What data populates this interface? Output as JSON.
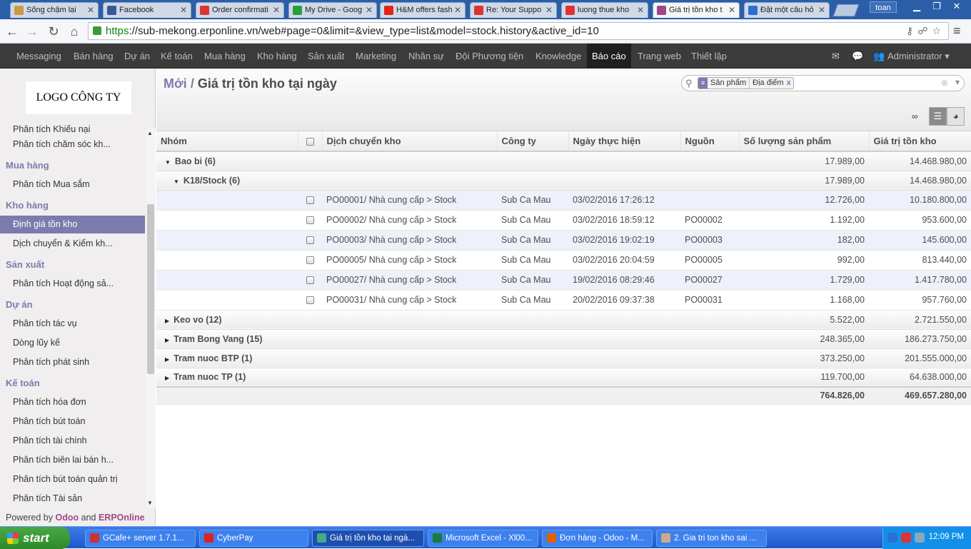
{
  "browser": {
    "tabs": [
      {
        "title": "Sống chậm lại",
        "icon": "image-icon",
        "color": "#c94"
      },
      {
        "title": "Facebook",
        "icon": "facebook-icon",
        "color": "#3b5998"
      },
      {
        "title": "Order confirmati",
        "icon": "gmail-icon",
        "color": "#d33"
      },
      {
        "title": "My Drive - Goog",
        "icon": "drive-icon",
        "color": "#2a9d3f"
      },
      {
        "title": "H&M offers fash",
        "icon": "hm-icon",
        "color": "#e1251b"
      },
      {
        "title": "Re: Your Suppo",
        "icon": "gmail-icon",
        "color": "#d33"
      },
      {
        "title": "luong thue kho",
        "icon": "gmail-icon",
        "color": "#d33"
      },
      {
        "title": "Giá trị tồn kho t",
        "icon": "odoo-icon",
        "color": "#a24689"
      },
      {
        "title": "Đặt một câu hỏ",
        "icon": "globe-icon",
        "color": "#2a6fd6"
      }
    ],
    "user": "toan",
    "url_scheme": "https",
    "url_rest": "://sub-mekong.erponline.vn/web#page=0&limit=&view_type=list&model=stock.history&active_id=10"
  },
  "topmenu": {
    "items": [
      "Messaging",
      "Bán hàng",
      "Dự án",
      "Kế toán",
      "Mua hàng",
      "Kho hàng",
      "Sản xuất",
      "Marketing",
      "Nhân sự",
      "Đội Phương tiện",
      "Knowledge",
      "Báo cáo",
      "Trang web",
      "Thiết lập"
    ],
    "active": "Báo cáo",
    "user": "Administrator"
  },
  "sidebar": {
    "logo": "LOGO CÔNG TY",
    "top_clipped": "Phân tích Khiếu nại",
    "sections": [
      {
        "title": "",
        "items": [
          "Phân tích chăm sóc kh..."
        ]
      },
      {
        "title": "Mua hàng",
        "items": [
          "Phân tích Mua sắm"
        ]
      },
      {
        "title": "Kho hàng",
        "items": [
          "Định giá tồn kho",
          "Dịch chuyển & Kiểm kh..."
        ]
      },
      {
        "title": "Sản xuất",
        "items": [
          "Phân tích Hoạt động sả..."
        ]
      },
      {
        "title": "Dự án",
        "items": [
          "Phân tích tác vụ",
          "Dòng lũy kế",
          "Phân tích phát sinh"
        ]
      },
      {
        "title": "Kế toán",
        "items": [
          "Phân tích hóa đơn",
          "Phân tích bút toán",
          "Phân tích tài chính",
          "Phân tích biên lai bán h...",
          "Phân tích bút toán quản trị",
          "Phân tích Tài sản"
        ]
      }
    ],
    "selected": "Định giá tồn kho",
    "powered_prefix": "Powered by",
    "powered_odoo": "Odoo",
    "powered_and": "and",
    "powered_erp": "ERPOnline"
  },
  "page": {
    "breadcrumb_link": "Mới",
    "breadcrumb_sep": "/",
    "title": "Giá trị tồn kho tại ngày",
    "facets": [
      "Sản phẩm",
      "Địa điểm"
    ],
    "infinity": "∞"
  },
  "table": {
    "columns": [
      "Nhóm",
      "",
      "Dịch chuyển kho",
      "Công ty",
      "Ngày thực hiện",
      "Nguồn",
      "Số lượng sản phẩm",
      "Giá trị tồn kho"
    ],
    "rows": [
      {
        "kind": "group",
        "level": 0,
        "open": true,
        "label": "Bao bi (6)",
        "qty": "17.989,00",
        "value": "14.468.980,00"
      },
      {
        "kind": "group",
        "level": 1,
        "open": true,
        "label": "K18/Stock (6)",
        "qty": "17.989,00",
        "value": "14.468.980,00"
      },
      {
        "kind": "record",
        "move": "PO00001/ Nhà cung cấp > Stock",
        "company": "Sub Ca Mau",
        "date": "03/02/2016 17:26:12",
        "source": "",
        "qty": "12.726,00",
        "value": "10.180.800,00"
      },
      {
        "kind": "record",
        "move": "PO00002/ Nhà cung cấp > Stock",
        "company": "Sub Ca Mau",
        "date": "03/02/2016 18:59:12",
        "source": "PO00002",
        "qty": "1.192,00",
        "value": "953.600,00"
      },
      {
        "kind": "record",
        "move": "PO00003/ Nhà cung cấp > Stock",
        "company": "Sub Ca Mau",
        "date": "03/02/2016 19:02:19",
        "source": "PO00003",
        "qty": "182,00",
        "value": "145.600,00"
      },
      {
        "kind": "record",
        "move": "PO00005/ Nhà cung cấp > Stock",
        "company": "Sub Ca Mau",
        "date": "03/02/2016 20:04:59",
        "source": "PO00005",
        "qty": "992,00",
        "value": "813.440,00"
      },
      {
        "kind": "record",
        "move": "PO00027/ Nhà cung cấp > Stock",
        "company": "Sub Ca Mau",
        "date": "19/02/2016 08:29:46",
        "source": "PO00027",
        "qty": "1.729,00",
        "value": "1.417.780,00"
      },
      {
        "kind": "record",
        "move": "PO00031/ Nhà cung cấp > Stock",
        "company": "Sub Ca Mau",
        "date": "20/02/2016 09:37:38",
        "source": "PO00031",
        "qty": "1.168,00",
        "value": "957.760,00"
      },
      {
        "kind": "group",
        "level": 0,
        "open": false,
        "label": "Keo vo (12)",
        "qty": "5.522,00",
        "value": "2.721.550,00"
      },
      {
        "kind": "group",
        "level": 0,
        "open": false,
        "label": "Tram Bong Vang (15)",
        "qty": "248.365,00",
        "value": "186.273.750,00"
      },
      {
        "kind": "group",
        "level": 0,
        "open": false,
        "label": "Tram nuoc BTP (1)",
        "qty": "373.250,00",
        "value": "201.555.000,00"
      },
      {
        "kind": "group",
        "level": 0,
        "open": false,
        "label": "Tram nuoc TP (1)",
        "qty": "119.700,00",
        "value": "64.638.000,00"
      }
    ],
    "total_qty": "764.826,00",
    "total_value": "469.657.280,00"
  },
  "taskbar": {
    "start": "start",
    "items": [
      {
        "title": "GCafe+ server 1.7.1...",
        "color": "#c33"
      },
      {
        "title": "CyberPay",
        "color": "#d22"
      },
      {
        "title": "Giá trị tồn kho tại ngà...",
        "color": "#4a8",
        "active": true
      },
      {
        "title": "Microsoft Excel - Xl00...",
        "color": "#1d7a3a"
      },
      {
        "title": "Đơn hàng - Odoo - M...",
        "color": "#e66000"
      },
      {
        "title": "2. Gia tri ton kho sai ...",
        "color": "#ca8"
      }
    ],
    "clock": "12:09 PM"
  }
}
